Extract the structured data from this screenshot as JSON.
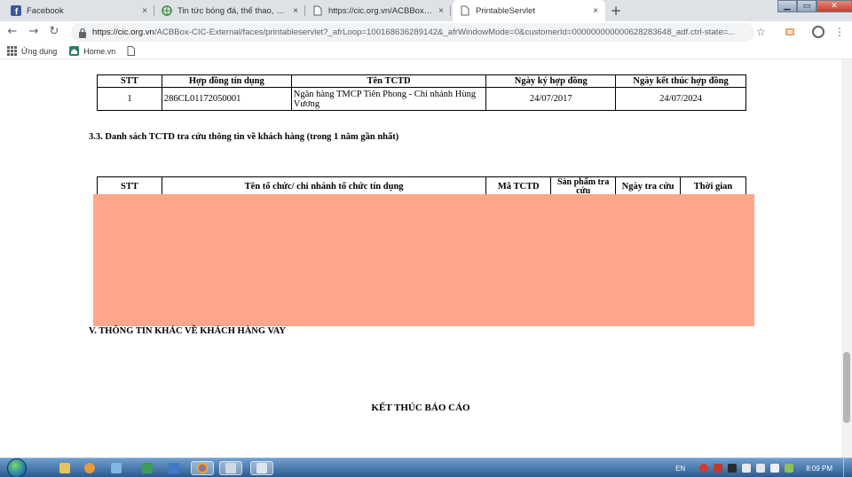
{
  "browser": {
    "tabs": [
      {
        "title": "Facebook",
        "icon": "facebook-icon",
        "close": "×"
      },
      {
        "title": "Tin tức bóng đá, thể thao, giải trí",
        "icon": "globe-icon",
        "close": "×"
      },
      {
        "title": "https://cic.org.vn/ACBBox-CIC-E",
        "icon": "page-icon",
        "close": "×"
      },
      {
        "title": "PrintableServlet",
        "icon": "page-icon",
        "close": "×"
      }
    ],
    "new_tab": "+",
    "url_host": "https://cic.org.vn",
    "url_path": "/ACBBox-CIC-External/faces/printableservlet?_afrLoop=100168636289142&_afrWindowMode=0&customerId=000000000000628283648_adf.ctrl-state=..."
  },
  "bookmarks": [
    {
      "label": "Ứng dụng",
      "icon": "apps-grid-icon"
    },
    {
      "label": "Home.vn",
      "icon": "home-icon"
    },
    {
      "label": "",
      "icon": "page-icon"
    }
  ],
  "report": {
    "credit_table": {
      "headers": [
        "STT",
        "Hợp đồng tín dụng",
        "Tên TCTD",
        "Ngày ký hợp đồng",
        "Ngày kết thúc hợp đồng"
      ],
      "rows": [
        [
          "1",
          "286CL01172050001",
          "Ngân hàng TMCP Tiên Phong - Chi nhánh Hùng Vương",
          "24/07/2017",
          "24/07/2024"
        ]
      ]
    },
    "section_33": "3.3. Danh sách TCTD tra cứu thông tin về khách hàng (trong 1 năm gần nhất)",
    "lookup_table": {
      "headers": [
        "STT",
        "Tên tổ chức/ chi nhánh tổ chức tín dụng",
        "Mã TCTD",
        "Sản phẩm tra cứu",
        "Ngày tra cứu",
        "Thời gian"
      ]
    },
    "redaction_color": "#fda68c",
    "section_v": "V. THÔNG TIN KHÁC VỀ KHÁCH HÀNG VAY",
    "end_text": "KẾT THÚC BÁO CÁO"
  },
  "taskbar": {
    "language": "EN",
    "clock": "8:09 PM"
  }
}
